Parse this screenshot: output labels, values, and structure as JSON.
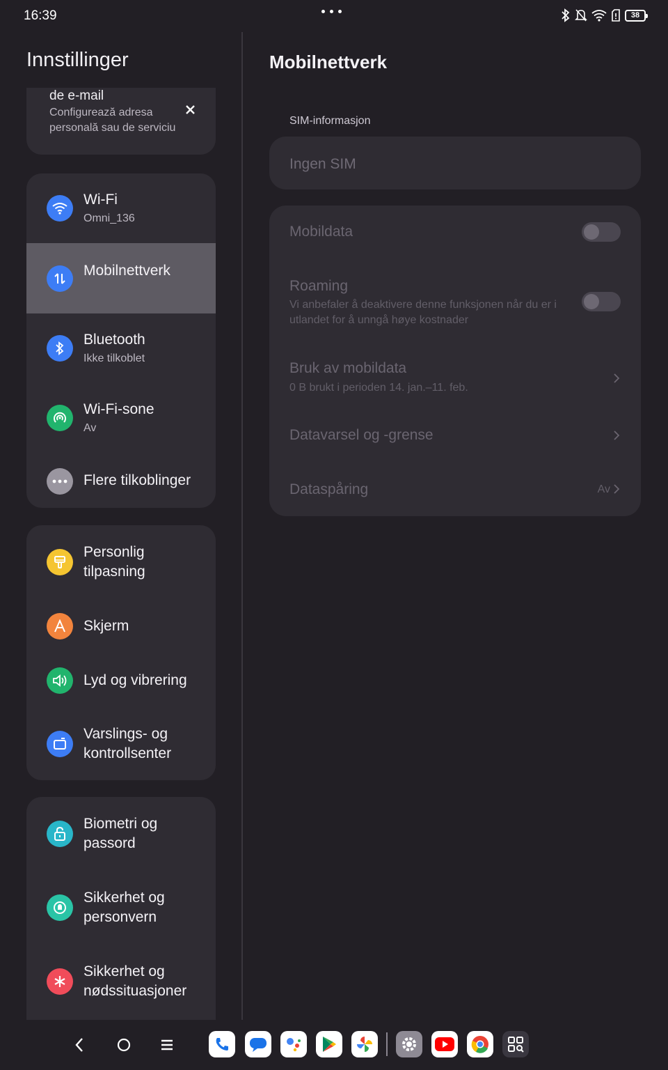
{
  "status_bar": {
    "time": "16:39",
    "battery": "38",
    "icons": [
      "bluetooth-icon",
      "silent-bell-icon",
      "wifi-icon",
      "sim-icon",
      "battery-icon"
    ]
  },
  "left": {
    "title": "Innstillinger",
    "banner": {
      "title": "de e-mail",
      "subtitle": "Configurează adresa personală sau de serviciu"
    },
    "groups": [
      {
        "items": [
          {
            "label": "Wi-Fi",
            "sub": "Omni_136",
            "icon": "wifi-icon",
            "color": "#3d7df5"
          },
          {
            "label": "Mobilnettverk",
            "sub": "",
            "icon": "mobile-data-icon",
            "color": "#3d7df5",
            "selected": true
          },
          {
            "label": "Bluetooth",
            "sub": "Ikke tilkoblet",
            "icon": "bluetooth-icon",
            "color": "#3d7df5"
          },
          {
            "label": "Wi-Fi-sone",
            "sub": "Av",
            "icon": "hotspot-icon",
            "color": "#21b46d"
          },
          {
            "label": "Flere tilkoblinger",
            "sub": "",
            "icon": "more-icon",
            "color": "#9a96a0"
          }
        ]
      },
      {
        "items": [
          {
            "label": "Personlig tilpasning",
            "icon": "brush-icon",
            "color": "#f5c531"
          },
          {
            "label": "Skjerm",
            "icon": "display-icon",
            "color": "#f2843d"
          },
          {
            "label": "Lyd og vibrering",
            "icon": "sound-icon",
            "color": "#21b46d"
          },
          {
            "label": "Varslings- og kontrollsenter",
            "icon": "notification-icon",
            "color": "#3d7df5"
          }
        ]
      },
      {
        "items": [
          {
            "label": "Biometri og passord",
            "icon": "lock-icon",
            "color": "#29b6c9"
          },
          {
            "label": "Sikkerhet og personvern",
            "icon": "shield-icon",
            "color": "#2ac4a6"
          },
          {
            "label": "Sikkerhet og nødssituasjoner",
            "icon": "emergency-icon",
            "color": "#f04c5a"
          }
        ]
      }
    ]
  },
  "right": {
    "title": "Mobilnettverk",
    "sim_header": "SIM-informasjon",
    "sim_value": "Ingen SIM",
    "mobile_data": {
      "label": "Mobildata",
      "enabled": false
    },
    "roaming": {
      "label": "Roaming",
      "sub": "Vi anbefaler å deaktivere denne funksjonen når du er i utlandet for å unngå høye kostnader",
      "enabled": false
    },
    "usage": {
      "label": "Bruk av mobildata",
      "sub": "0 B brukt i perioden 14. jan.–11. feb."
    },
    "data_warning": {
      "label": "Datavarsel og -grense"
    },
    "data_saver": {
      "label": "Dataspåring",
      "value": "Av"
    }
  },
  "dock": [
    "phone-app-icon",
    "messages-app-icon",
    "assistant-app-icon",
    "play-store-app-icon",
    "photos-app-icon",
    "settings-app-icon",
    "youtube-app-icon",
    "chrome-app-icon",
    "qr-scanner-app-icon"
  ]
}
